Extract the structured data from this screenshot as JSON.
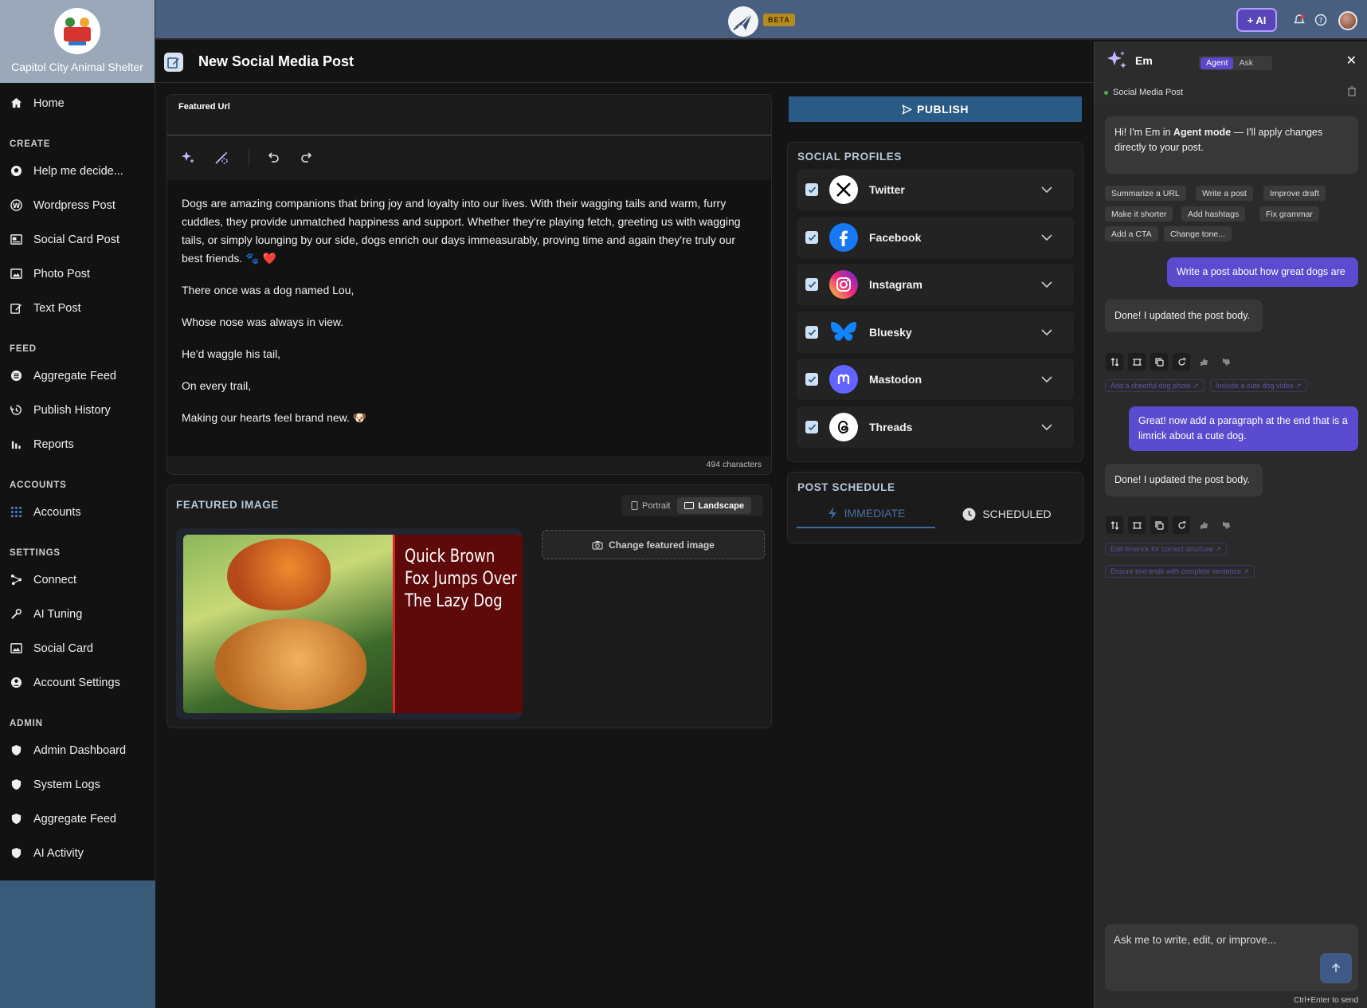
{
  "app": {
    "beta_badge": "BETA"
  },
  "topbar": {
    "ai_button": "+ AI"
  },
  "sidebar": {
    "org_name": "Capitol City Animal Shelter",
    "home": "Home",
    "sections": [
      {
        "heading": "CREATE",
        "items": [
          "Help me decide...",
          "Wordpress Post",
          "Social Card Post",
          "Photo Post",
          "Text Post"
        ]
      },
      {
        "heading": "FEED",
        "items": [
          "Aggregate Feed",
          "Publish History",
          "Reports"
        ]
      },
      {
        "heading": "ACCOUNTS",
        "items": [
          "Accounts"
        ]
      },
      {
        "heading": "SETTINGS",
        "items": [
          "Connect",
          "AI Tuning",
          "Social Card",
          "Account Settings"
        ]
      },
      {
        "heading": "ADMIN",
        "items": [
          "Admin Dashboard",
          "System Logs",
          "Aggregate Feed",
          "AI Activity"
        ]
      }
    ]
  },
  "page": {
    "title": "New Social Media Post"
  },
  "editor": {
    "featured_url_label": "Featured Url",
    "paragraphs": [
      "Dogs are amazing companions that bring joy and loyalty into our lives. With their wagging tails and warm, furry cuddles, they provide unmatched happiness and support. Whether they're playing fetch, greeting us with wagging tails, or simply lounging by our side, dogs enrich our days immeasurably, proving time and again they're truly our best friends. 🐾 ❤️",
      "There once was a dog named Lou,",
      "Whose nose was always in view.",
      "He'd waggle his tail,",
      "On every trail,",
      "Making our hearts feel brand new. 🐶"
    ],
    "char_count": "494 characters"
  },
  "featured_image": {
    "title": "FEATURED IMAGE",
    "portrait": "Portrait",
    "landscape": "Landscape",
    "overlay_text": "Quick Brown Fox Jumps Over The Lazy Dog",
    "change_button": "Change featured image"
  },
  "publish": {
    "label": "PUBLISH"
  },
  "profiles": {
    "title": "SOCIAL PROFILES",
    "items": [
      {
        "name": "Twitter",
        "checked": true,
        "color": "#000000"
      },
      {
        "name": "Facebook",
        "checked": true,
        "color": "#1877f2"
      },
      {
        "name": "Instagram",
        "checked": true,
        "color": "#e1306c"
      },
      {
        "name": "Bluesky",
        "checked": true,
        "color": "#1185fe"
      },
      {
        "name": "Mastodon",
        "checked": true,
        "color": "#6364ff"
      },
      {
        "name": "Threads",
        "checked": true,
        "color": "#000000"
      }
    ]
  },
  "schedule": {
    "title": "POST SCHEDULE",
    "immediate": "IMMEDIATE",
    "scheduled": "SCHEDULED"
  },
  "ai": {
    "name": "Em",
    "mode_agent": "Agent",
    "mode_ask": "Ask",
    "context": "Social Media Post",
    "intro": "Hi! I'm Em in Agent mode — I'll apply changes directly to your post.",
    "intro_parts": {
      "a": "Hi! I'm Em in ",
      "b": "Agent mode",
      "c": " — I'll apply changes directly to your post."
    },
    "chips": [
      "Summarize a URL",
      "Write a post",
      "Improve draft",
      "Make it shorter",
      "Add hashtags",
      "Fix grammar",
      "Add a CTA",
      "Change tone..."
    ],
    "messages": [
      {
        "role": "user",
        "text": "Write a post about how great dogs are"
      },
      {
        "role": "assistant",
        "text": "Done! I updated the post body.",
        "suggestions": [
          "Add a cheerful dog photo ↗",
          "Include a cute dog video ↗"
        ]
      },
      {
        "role": "user",
        "text": "Great! now add a paragraph at the end that is a limrick about a cute dog."
      },
      {
        "role": "assistant",
        "text": "Done! I updated the post body.",
        "suggestions": [
          "Edit limerick for correct structure ↗",
          "Ensure text ends with complete sentence ↗"
        ]
      }
    ],
    "input_placeholder": "Ask me to write, edit, or improve...",
    "send_hint": "Ctrl+Enter to send"
  }
}
